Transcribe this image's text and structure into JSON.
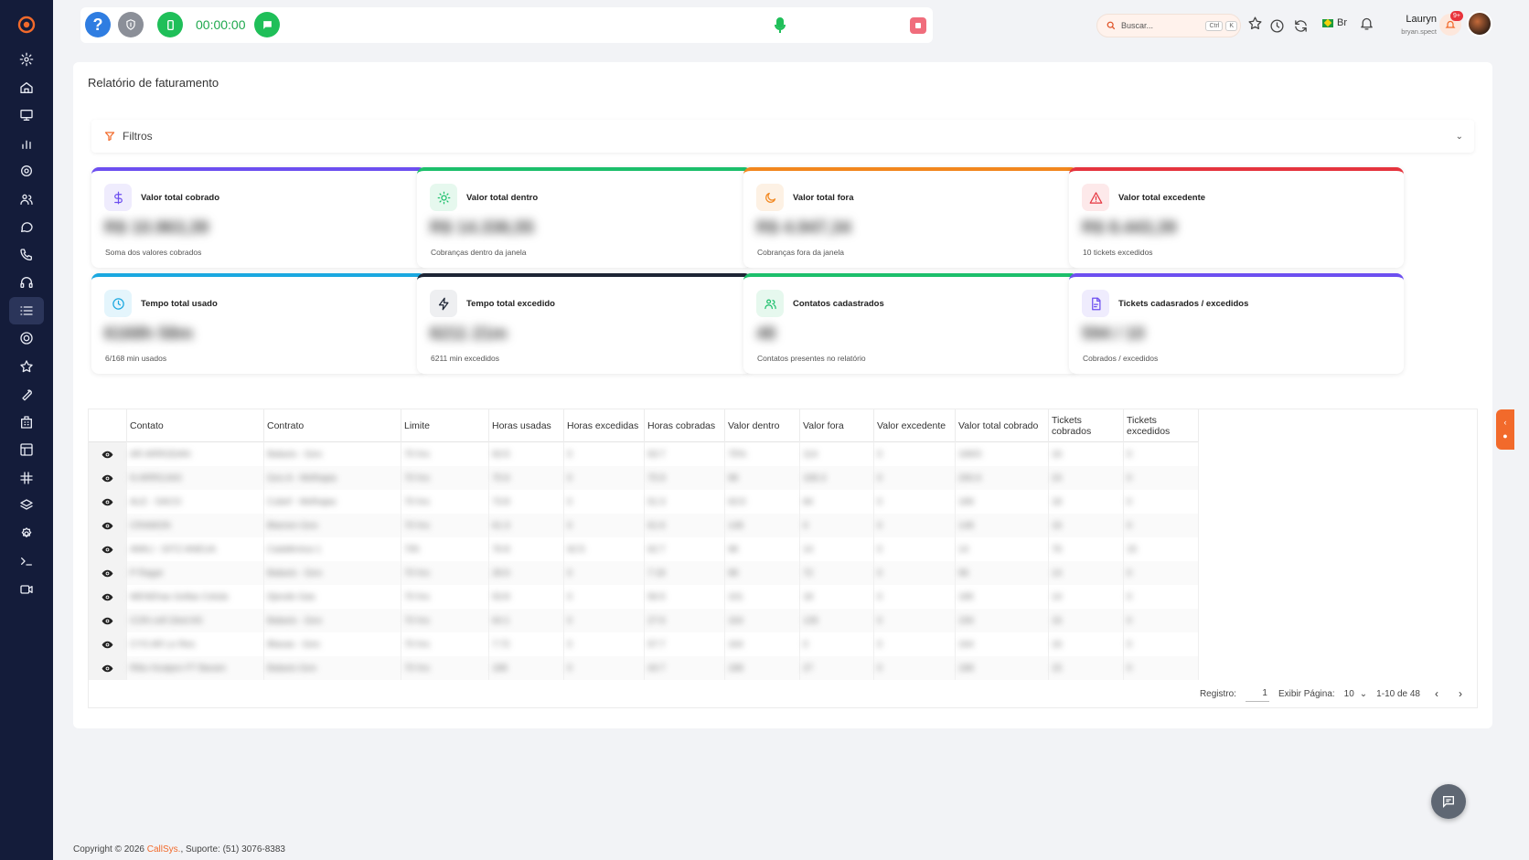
{
  "topbar": {
    "help_label": "?",
    "timer": "00:00:00"
  },
  "search": {
    "placeholder": "Buscar...",
    "kbd1": "Ctrl",
    "kbd2": "K"
  },
  "language": "Br",
  "user": {
    "name": "Lauryn",
    "username": "bryan.spect",
    "notifications": "9+"
  },
  "page": {
    "title": "Relatório de faturamento",
    "filters_label": "Filtros"
  },
  "colors": {
    "accent": "#f26a2b",
    "sidebar_bg": "#141c3a",
    "green": "#1fbf59"
  },
  "stats": [
    {
      "label": "Valor total cobrado",
      "value": "R$ 10.963,39",
      "sub": "Soma dos valores cobrados",
      "color": "#6d4ff0",
      "icon": "dollar-icon"
    },
    {
      "label": "Valor total dentro",
      "value": "R$ 14.336,55",
      "sub": "Cobranças dentro da janela",
      "color": "#1cbf6b",
      "icon": "sun-icon"
    },
    {
      "label": "Valor total fora",
      "value": "R$ 4.947,34",
      "sub": "Cobranças fora da janela",
      "color": "#f2871e",
      "icon": "moon-icon"
    },
    {
      "label": "Valor total excedente",
      "value": "R$ 8.443,39",
      "sub": "10 tickets excedidos",
      "color": "#e5343e",
      "icon": "warning-icon"
    },
    {
      "label": "Tempo total usado",
      "value": "6168h 58m",
      "sub": "6/168 min usados",
      "color": "#1aa8e0",
      "icon": "clock-icon"
    },
    {
      "label": "Tempo total excedido",
      "value": "6211 21m",
      "sub": "6211 min excedidos",
      "color": "#1d2535",
      "icon": "bolt-icon"
    },
    {
      "label": "Contatos cadastrados",
      "value": "48",
      "sub": "Contatos presentes no relatório",
      "color": "#1cbf6b",
      "icon": "users-icon"
    },
    {
      "label": "Tickets cadasrados / excedidos",
      "value": "594 / 10",
      "sub": "Cobrados / excedidos",
      "color": "#6d4ff0",
      "icon": "ticket-icon"
    }
  ],
  "table": {
    "columns": [
      "Contato",
      "Contrato",
      "Limite",
      "Horas usadas",
      "Horas excedidas",
      "Horas cobradas",
      "Valor dentro",
      "Valor fora",
      "Valor excedente",
      "Valor total cobrado",
      "Tickets cobrados",
      "Tickets excedidos"
    ],
    "rows": [
      [
        "AR ARRODAN",
        "Balaxis - Geo",
        "70 hrs",
        "63:5",
        "0",
        "63:7",
        "75%",
        "114",
        "0",
        "189/3",
        "16",
        "0"
      ],
      [
        "N ARROJAS",
        "Geo A - Melhajas",
        "70 hrs",
        "75:6",
        "0",
        "75:9",
        "98",
        "168.3",
        "0",
        "266.6",
        "24",
        "0"
      ],
      [
        "ALE - SACO",
        "Cubef - Melhajas",
        "70 hrs",
        "73:8",
        "0",
        "51:3",
        "63:5",
        "84",
        "0",
        "189",
        "18",
        "0"
      ],
      [
        "CRAMON",
        "Blamen Geo",
        "70 hrs",
        "61:3",
        "0",
        "61:6",
        "148",
        "0",
        "0",
        "148",
        "16",
        "0"
      ],
      [
        "AMILI - DITZ ANEUA",
        "Cadafenica 1",
        "70h",
        "76:8",
        "62:5",
        "62:7",
        "98",
        "14",
        "0",
        "14",
        "76",
        "15"
      ],
      [
        "P Ragar",
        "Balaxis - Geo",
        "70 hrs",
        "28:6",
        "0",
        "7:18",
        "98",
        "72",
        "0",
        "96",
        "14",
        "0"
      ],
      [
        "MENEhas Gellas Celula",
        "Djeodo Gas",
        "70 hrs",
        "53:8",
        "0",
        "56:5",
        "101",
        "18",
        "0",
        "185",
        "14",
        "0"
      ],
      [
        "CON cell Gled AS",
        "Balaxis - Geo",
        "70 hrs",
        "64:1",
        "0",
        "27:6",
        "164",
        "135",
        "0",
        "156",
        "16",
        "0"
      ],
      [
        "CYS AR Le Res",
        "Blaxas - Geo",
        "70 hrs",
        "7:72",
        "0",
        "57:7",
        "164",
        "0",
        "0",
        "164",
        "16",
        "0"
      ],
      [
        "Ribs Hcatpre FT Baram",
        "Balaxis Geo",
        "70 hrs",
        "188",
        "0",
        "44:7",
        "188",
        "27",
        "0",
        "188",
        "15",
        "0"
      ]
    ]
  },
  "pager": {
    "registro_label": "Registro:",
    "registro_value": "1",
    "exibir_label": "Exibir Página:",
    "per_page": "10",
    "range": "1-10 de 48"
  },
  "footer": {
    "prefix": "Copyright © 2026 ",
    "brand": "CallSys.",
    "suffix": ", Suporte: (51) 3076-8383"
  },
  "sidebar_items": [
    "settings-icon",
    "home-icon",
    "monitor-icon",
    "chart-icon",
    "gear-icon",
    "team-icon",
    "message-icon",
    "phone-icon",
    "headset-icon",
    "list-icon",
    "cog-icon",
    "star-icon",
    "wrench-icon",
    "building-icon",
    "layout-icon",
    "hash-icon",
    "layers-icon",
    "settings2-icon",
    "terminal-icon",
    "video-icon"
  ]
}
